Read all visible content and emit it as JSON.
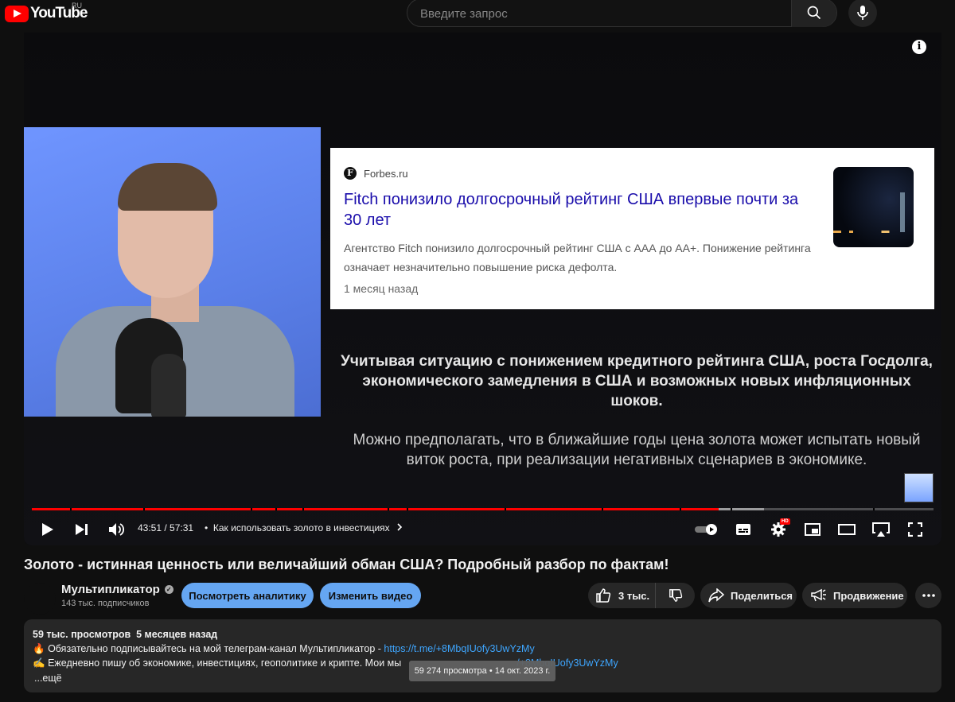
{
  "header": {
    "logo_text": "YouTube",
    "region": "RU",
    "search_placeholder": "Введите запрос"
  },
  "player": {
    "news_card": {
      "source": "Forbes.ru",
      "source_letter": "F",
      "title": "Fitch понизило долгосрочный рейтинг США впервые почти за 30 лет",
      "description": "Агентство Fitch понизило долгосрочный рейтинг США с ААА до АА+. Понижение рейтинга означает незначительно повышение риска дефолта.",
      "time": "1 месяц назад"
    },
    "overlay_text_1": "Учитывая ситуацию с понижением кредитного рейтинга США, роста Госдолга, экономического замедления в США и возможных новых инфляционных шоков.",
    "overlay_text_2": "Можно предполагать, что в ближайшие годы цена золота может испытать новый виток роста, при реализации негативных сценариев в экономике.",
    "time_display": "43:51 / 57:31",
    "chapter_separator": "•",
    "chapter": "Как использовать золото в инвестициях",
    "progress_fraction": 0.762,
    "hd_badge": "HD"
  },
  "video": {
    "title": "Золото - истинная ценность или величайший обман США? Подробный разбор по фактам!",
    "channel_name": "Мультипликатор",
    "subscribers": "143 тыс. подписчиков",
    "analytics_button": "Посмотреть аналитику",
    "edit_button": "Изменить видео",
    "likes": "3 тыс.",
    "share_button": "Поделиться",
    "promote_button": "Продвижение"
  },
  "description": {
    "views": "59 тыс. просмотров",
    "age": "5 месяцев назад",
    "line1_emoji": "🔥",
    "line1_text": "Обязательно подписывайтесь на мой телеграм-канал Мультипликатор - ",
    "line1_link": "https://t.me/+8MbqIUofy3UwYzMy",
    "line2_emoji": "✍",
    "line2_text": "Ежедневно пишу об экономике, инвестициях, геополитике и крипте. Мои мы",
    "line2_link": "/+8MbqIUofy3UwYzMy",
    "more": "...ещё",
    "tooltip": "59 274 просмотра • 14 окт. 2023 г."
  },
  "colors": {
    "accent_red": "#ff0000",
    "button_blue": "#65a6f2",
    "link_blue": "#3ea6ff"
  }
}
